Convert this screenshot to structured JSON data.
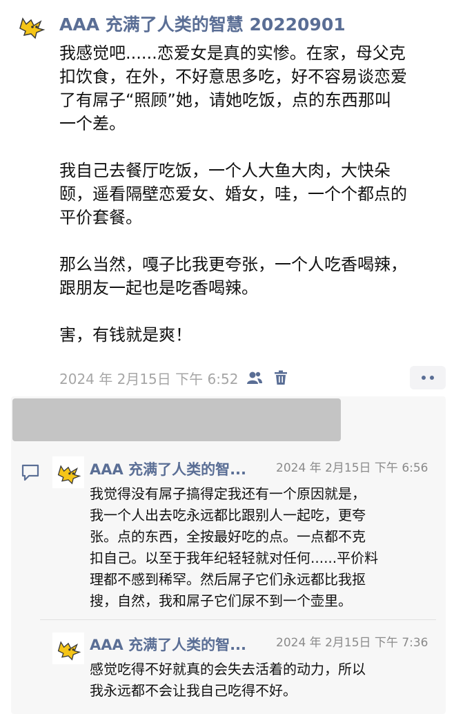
{
  "post": {
    "author": "AAA 充满了人类的智慧 20220901",
    "paragraphs": [
      [
        "我感觉吧......恋爱女是真的实惨。在家，母父克",
        "扣饮食，在外，不好意思多吃，好不容易谈恋爱",
        "了有屌子“照顾”她，请她吃饭，点的东西那叫",
        "一个差。"
      ],
      [
        "我自己去餐厅吃饭，一个人大鱼大肉，大快朵",
        "颐，遥看隔壁恋爱女、婚女，哇，一个个都点的",
        "平价套餐。"
      ],
      [
        "那么当然，嘎子比我更夸张，一个人吃香喝辣，",
        "跟朋友一起也是吃香喝辣。"
      ],
      [
        "害，有钱就是爽！"
      ]
    ],
    "timestamp": "2024 年 2月15日 下午 6:52",
    "icons": [
      "visibility-group-icon",
      "delete-icon",
      "more-dots-icon"
    ]
  },
  "comments": [
    {
      "author": "AAA 充满了人类的智...",
      "timestamp": "2024 年 2月15日 下午 6:56",
      "lines": [
        "我觉得没有屌子搞得定我还有一个原因就是，",
        "我一个人出去吃永远都比跟别人一起吃，更夸",
        "张。点的东西，全按最好吃的点。一点都不克",
        "扣自己。以至于我年纪轻轻就对任何......平价料",
        "理都不感到稀罕。然后屌子它们永远都比我抠",
        "搜，自然，我和屌子它们尿不到一个壶里。"
      ]
    },
    {
      "author": "AAA 充满了人类的智...",
      "timestamp": "2024 年 2月15日 下午 7:36",
      "lines": [
        "感觉吃得不好就真的会失去活着的动力，所以",
        "我永远都不会让我自己吃得不好。"
      ]
    }
  ],
  "colors": {
    "name": "#5a6e95",
    "accent": "#5a6e95",
    "meta": "#a6a6a6",
    "avatar_yellow": "#f5c518"
  }
}
